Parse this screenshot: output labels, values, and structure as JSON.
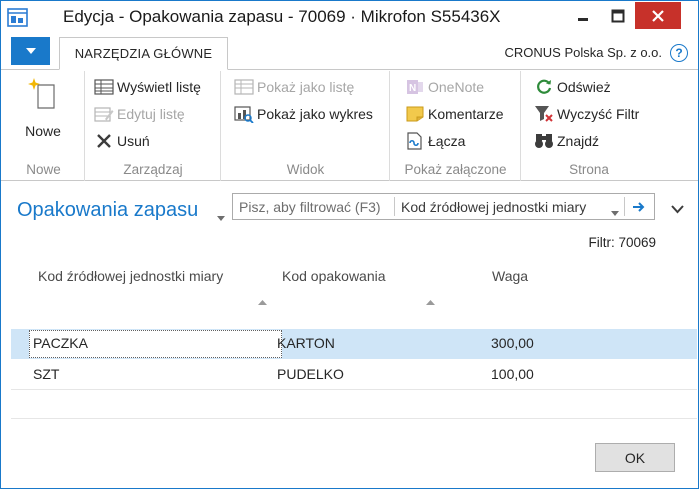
{
  "window": {
    "title": "Edycja - Opakowania zapasu - 70069 · Mikrofon S55436X"
  },
  "ribbon": {
    "tab_active": "NARZĘDZIA GŁÓWNE",
    "company": "CRONUS Polska Sp. z o.o.",
    "help_label": "?",
    "groups": {
      "nowe": {
        "label": "Nowe",
        "new_button": "Nowe"
      },
      "zarzadzaj": {
        "label": "Zarządzaj",
        "items": [
          "Wyświetl listę",
          "Edytuj listę",
          "Usuń"
        ]
      },
      "widok": {
        "label": "Widok",
        "items": [
          "Pokaż jako listę",
          "Pokaż jako wykres"
        ]
      },
      "zalaczone": {
        "label": "Pokaż załączone",
        "items": [
          "OneNote",
          "Komentarze",
          "Łącza"
        ]
      },
      "strona": {
        "label": "Strona",
        "items": [
          "Odśwież",
          "Wyczyść Filtr",
          "Znajdź"
        ]
      }
    }
  },
  "page": {
    "title": "Opakowania zapasu",
    "filter_placeholder": "Pisz, aby filtrować (F3)",
    "filter_field": "Kod źródłowej jednostki miary",
    "filter_label": "Filtr: 70069"
  },
  "table": {
    "columns": [
      "Kod źródłowej jednostki miary",
      "Kod opakowania",
      "Waga"
    ],
    "rows": [
      {
        "source_uom": "PACZKA",
        "package": "KARTON",
        "weight": "300,00"
      },
      {
        "source_uom": "SZT",
        "package": "PUDELKO",
        "weight": "100,00"
      }
    ]
  },
  "footer": {
    "ok_label": "OK"
  },
  "colors": {
    "accent": "#1979ca",
    "close_button": "#c7312a",
    "selected_row": "#cfe5f7",
    "disabled_text": "#a6a6a6"
  },
  "icons": {
    "app": "app-window-icon",
    "new": "new-sparkle-icon",
    "view_list": "view-list-icon",
    "edit_list": "edit-list-icon",
    "delete": "delete-x-icon",
    "show_as_list": "show-as-list-icon",
    "show_as_chart": "show-as-chart-icon",
    "onenote": "onenote-icon",
    "notes": "notes-icon",
    "links": "links-icon",
    "refresh": "refresh-icon",
    "clear_filter": "clear-filter-icon",
    "find": "binoculars-icon"
  }
}
